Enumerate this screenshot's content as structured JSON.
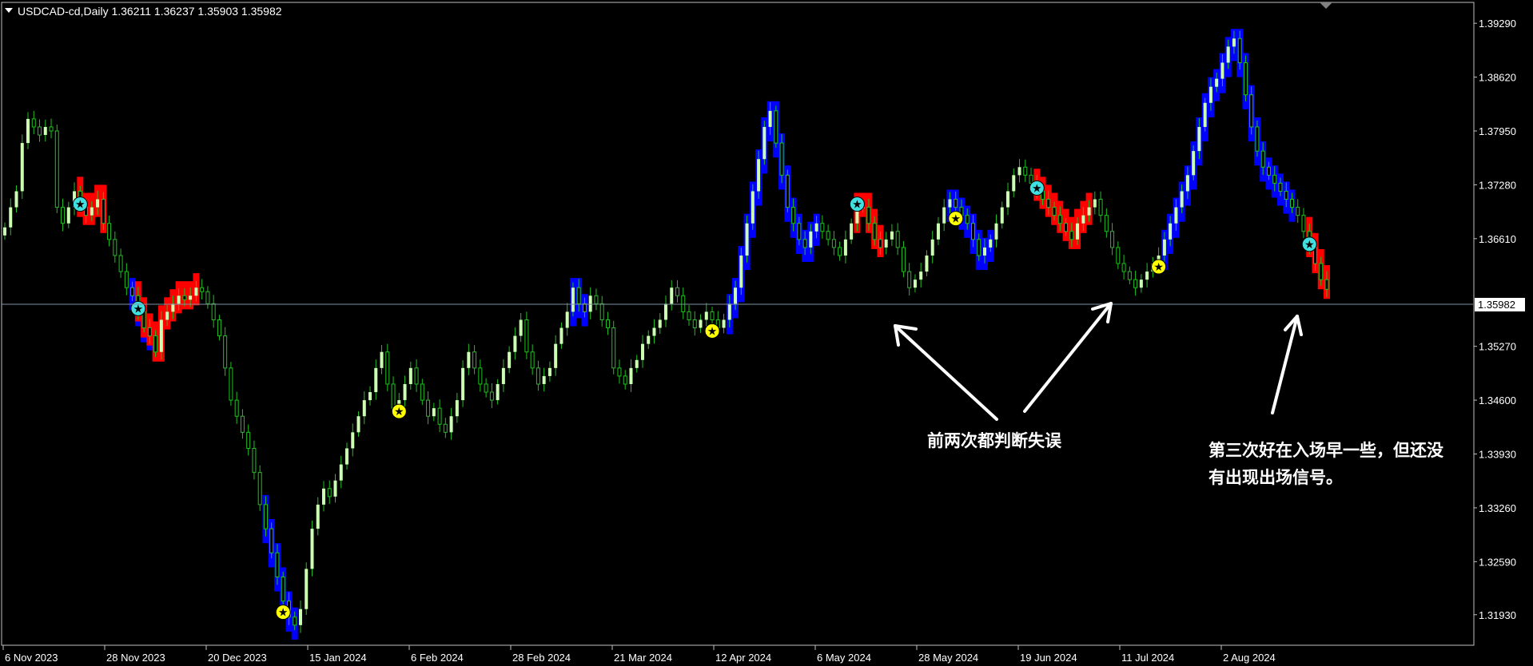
{
  "header": {
    "symbol_line": "USDCAD-cd,Daily  1.36211 1.36237 1.35903 1.35982"
  },
  "colors": {
    "background": "#000000",
    "grid_border": "#c0c0c0",
    "bull_body": "#ccffb3",
    "bull_wick": "#20c020",
    "bear_body": "#000000",
    "bear_outline": "#20c020",
    "band_up": "#0000ff",
    "band_down": "#ff0000",
    "signal_buy": "#ffff00",
    "signal_sell": "#40e0e0",
    "current_price_line": "#8090a0"
  },
  "chart_data": {
    "type": "candlestick",
    "instrument": "USDCAD-cd",
    "timeframe": "Daily",
    "ohlc_header": {
      "open": 1.36211,
      "high": 1.36237,
      "low": 1.35903,
      "close": 1.35982
    },
    "ylim": [
      1.3155,
      1.3955
    ],
    "y_ticks": [
      "1.39290",
      "1.38620",
      "1.37950",
      "1.37280",
      "1.36610",
      "1.35270",
      "1.34600",
      "1.33930",
      "1.33260",
      "1.32590",
      "1.31930"
    ],
    "current_price": "1.35982",
    "x_ticks": [
      "6 Nov 2023",
      "28 Nov 2023",
      "20 Dec 2023",
      "15 Jan 2024",
      "6 Feb 2024",
      "28 Feb 2024",
      "21 Mar 2024",
      "12 Apr 2024",
      "6 May 2024",
      "28 May 2024",
      "19 Jun 2024",
      "11 Jul 2024",
      "2 Aug 2024"
    ],
    "closes": [
      1.3675,
      1.37,
      1.372,
      1.378,
      1.381,
      1.38,
      1.379,
      1.38,
      1.3795,
      1.37,
      1.368,
      1.37,
      1.372,
      1.37,
      1.369,
      1.37,
      1.371,
      1.368,
      1.366,
      1.364,
      1.362,
      1.36,
      1.359,
      1.357,
      1.355,
      1.354,
      1.352,
      1.356,
      1.357,
      1.358,
      1.359,
      1.3585,
      1.359,
      1.36,
      1.3595,
      1.358,
      1.356,
      1.354,
      1.35,
      1.346,
      1.344,
      1.342,
      1.34,
      1.337,
      1.333,
      1.33,
      1.327,
      1.324,
      1.321,
      1.319,
      1.318,
      1.32,
      1.325,
      1.33,
      1.333,
      1.335,
      1.334,
      1.336,
      1.338,
      1.34,
      1.342,
      1.344,
      1.346,
      1.347,
      1.35,
      1.352,
      1.348,
      1.345,
      1.346,
      1.348,
      1.35,
      1.348,
      1.346,
      1.344,
      1.345,
      1.343,
      1.342,
      1.344,
      1.346,
      1.35,
      1.352,
      1.35,
      1.348,
      1.347,
      1.346,
      1.348,
      1.35,
      1.352,
      1.354,
      1.356,
      1.352,
      1.35,
      1.348,
      1.349,
      1.35,
      1.353,
      1.355,
      1.357,
      1.36,
      1.358,
      1.357,
      1.359,
      1.358,
      1.356,
      1.355,
      1.35,
      1.349,
      1.348,
      1.35,
      1.351,
      1.353,
      1.354,
      1.355,
      1.356,
      1.358,
      1.36,
      1.359,
      1.357,
      1.356,
      1.355,
      1.356,
      1.357,
      1.356,
      1.355,
      1.356,
      1.358,
      1.36,
      1.364,
      1.368,
      1.372,
      1.376,
      1.38,
      1.382,
      1.378,
      1.374,
      1.37,
      1.368,
      1.366,
      1.365,
      1.367,
      1.368,
      1.367,
      1.366,
      1.365,
      1.364,
      1.366,
      1.368,
      1.37,
      1.37,
      1.368,
      1.366,
      1.365,
      1.366,
      1.367,
      1.365,
      1.362,
      1.36,
      1.361,
      1.362,
      1.364,
      1.366,
      1.368,
      1.37,
      1.371,
      1.37,
      1.369,
      1.368,
      1.366,
      1.364,
      1.365,
      1.366,
      1.368,
      1.37,
      1.372,
      1.374,
      1.375,
      1.374,
      1.373,
      1.372,
      1.371,
      1.37,
      1.369,
      1.368,
      1.367,
      1.366,
      1.368,
      1.369,
      1.37,
      1.371,
      1.369,
      1.367,
      1.365,
      1.363,
      1.362,
      1.361,
      1.36,
      1.361,
      1.362,
      1.363,
      1.364,
      1.366,
      1.368,
      1.37,
      1.372,
      1.374,
      1.377,
      1.38,
      1.383,
      1.385,
      1.386,
      1.388,
      1.39,
      1.391,
      1.388,
      1.384,
      1.38,
      1.377,
      1.375,
      1.374,
      1.373,
      1.372,
      1.371,
      1.37,
      1.369,
      1.367,
      1.365,
      1.363,
      1.361,
      1.3598
    ],
    "blue_band": [
      [
        22,
        25
      ],
      [
        45,
        50
      ],
      [
        98,
        100
      ],
      [
        125,
        140
      ],
      [
        163,
        170
      ],
      [
        200,
        222
      ]
    ],
    "red_band": [
      [
        13,
        17
      ],
      [
        23,
        33
      ],
      [
        147,
        151
      ],
      [
        178,
        187
      ],
      [
        225,
        230
      ]
    ],
    "signals": [
      {
        "i": 13,
        "type": "sell"
      },
      {
        "i": 23,
        "type": "sell"
      },
      {
        "i": 48,
        "type": "buy"
      },
      {
        "i": 68,
        "type": "buy"
      },
      {
        "i": 122,
        "type": "buy"
      },
      {
        "i": 147,
        "type": "sell"
      },
      {
        "i": 164,
        "type": "buy"
      },
      {
        "i": 178,
        "type": "sell"
      },
      {
        "i": 199,
        "type": "buy"
      },
      {
        "i": 225,
        "type": "sell"
      }
    ]
  },
  "annotations": {
    "note1": "前两次都判断失误",
    "note2_line1": "第三次好在入场早一些，但还没",
    "note2_line2": "有出现出场信号。"
  }
}
